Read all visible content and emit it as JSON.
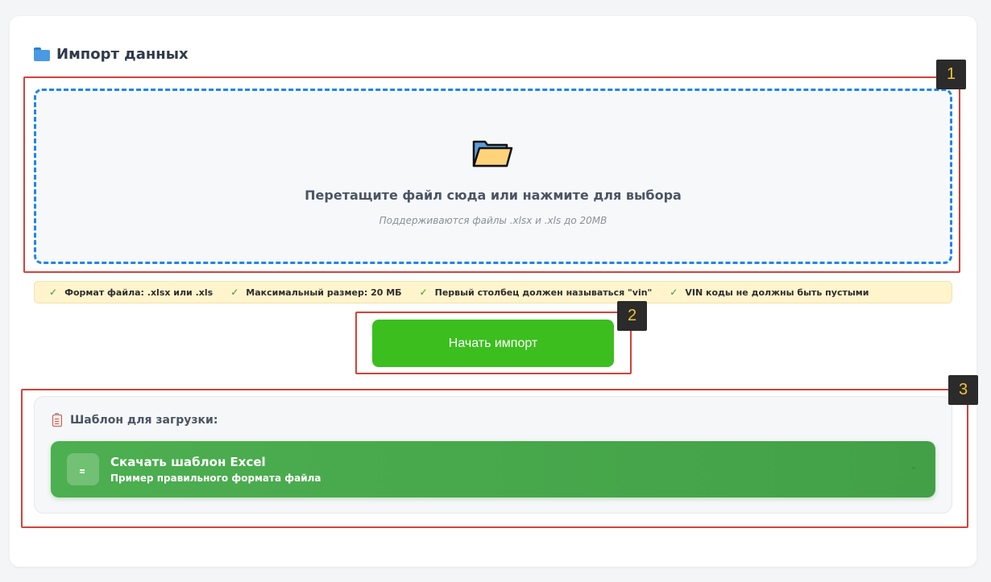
{
  "header": {
    "title": "Импорт данных",
    "icon": "folder-icon"
  },
  "dropzone": {
    "icon": "open-folder-icon",
    "title": "Перетащите файл сюда или нажмите для выбора",
    "subtitle": "Поддерживаются файлы .xlsx и .xls до 20MB",
    "border_color": "#1f86e8"
  },
  "requirements": [
    {
      "check": "✓",
      "text": "Формат файла: .xlsx или .xls"
    },
    {
      "check": "✓",
      "text": "Максимальный размер: 20 МБ"
    },
    {
      "check": "✓",
      "text": "Первый столбец должен называться \"vin\""
    },
    {
      "check": "✓",
      "text": "VIN коды не должны быть пустыми"
    }
  ],
  "actions": {
    "start_import_label": "Начать импорт",
    "start_import_color": "#3cbe1f"
  },
  "template": {
    "icon": "clipboard-icon",
    "heading": "Шаблон для загрузки:",
    "download_title": "Скачать шаблон Excel",
    "download_subtitle": "Пример правильного формата файла",
    "download_icon": "document-icon",
    "chevron": "⌄",
    "download_color": "#4caf50"
  },
  "annotations": [
    {
      "label": "1"
    },
    {
      "label": "2"
    },
    {
      "label": "3"
    }
  ]
}
